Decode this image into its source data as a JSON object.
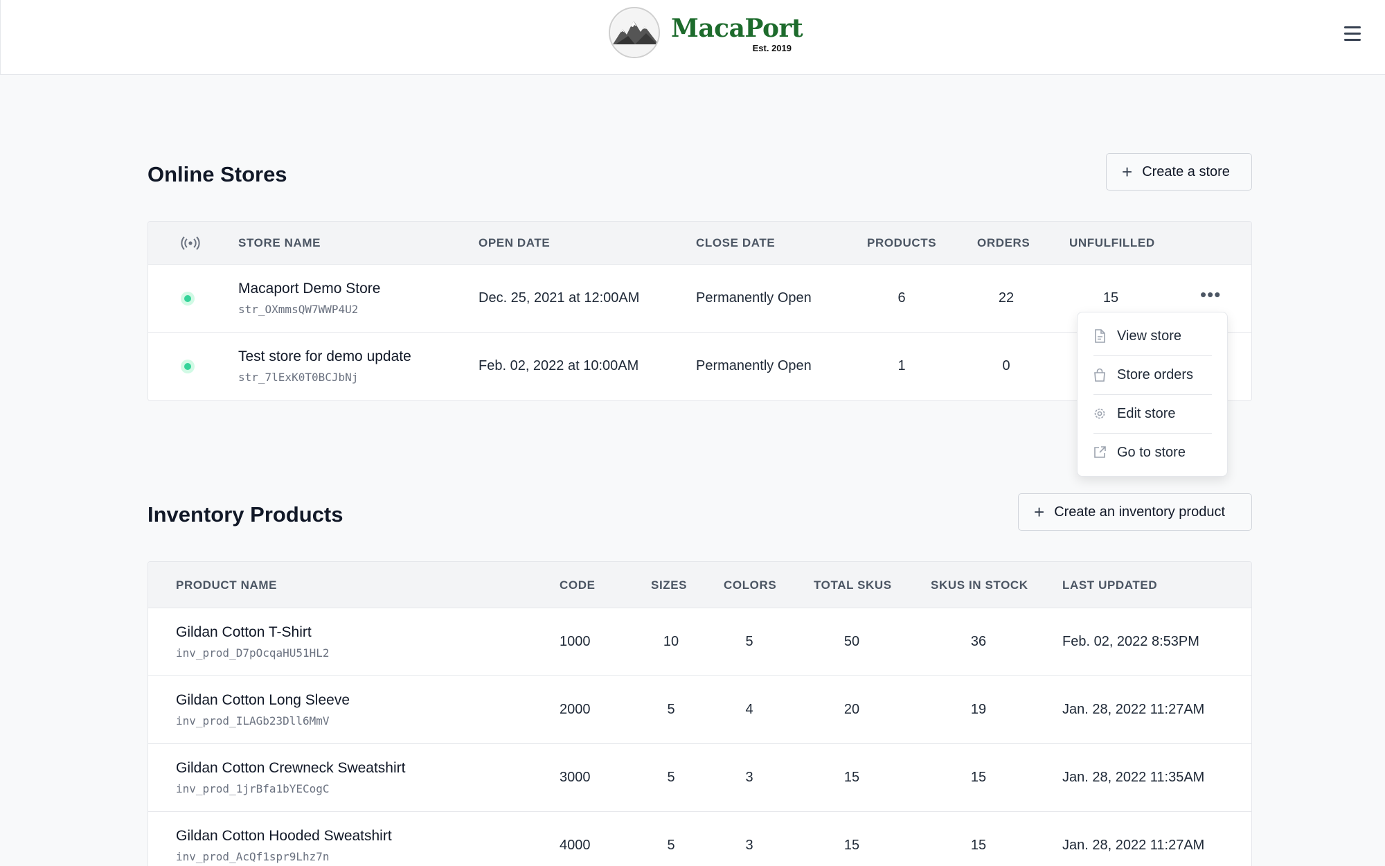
{
  "header": {
    "brand": "MacaPort",
    "established": "Est. 2019"
  },
  "stores": {
    "title": "Online Stores",
    "create_label": "Create a store",
    "columns": {
      "status_icon": "broadcast-icon",
      "store_name": "STORE NAME",
      "open_date": "OPEN DATE",
      "close_date": "CLOSE DATE",
      "products": "PRODUCTS",
      "orders": "ORDERS",
      "unfulfilled": "UNFULFILLED"
    },
    "rows": [
      {
        "status": "active",
        "name": "Macaport Demo Store",
        "id": "str_OXmmsQW7WWP4U2",
        "open_date": "Dec. 25, 2021 at 12:00AM",
        "close_date": "Permanently Open",
        "products": "6",
        "orders": "22",
        "unfulfilled": "15"
      },
      {
        "status": "active",
        "name": "Test store for demo update",
        "id": "str_7lExK0T0BCJbNj",
        "open_date": "Feb. 02, 2022 at 10:00AM",
        "close_date": "Permanently Open",
        "products": "1",
        "orders": "0",
        "unfulfilled": ""
      }
    ],
    "row_menu": {
      "items": [
        {
          "label": "View store",
          "icon": "document-icon"
        },
        {
          "label": "Store orders",
          "icon": "shopping-bag-icon"
        },
        {
          "label": "Edit store",
          "icon": "gear-icon"
        },
        {
          "label": "Go to store",
          "icon": "external-link-icon"
        }
      ]
    }
  },
  "inventory": {
    "title": "Inventory Products",
    "create_label": "Create an inventory product",
    "columns": {
      "product_name": "PRODUCT NAME",
      "code": "CODE",
      "sizes": "SIZES",
      "colors": "COLORS",
      "total_skus": "TOTAL SKUS",
      "skus_in_stock": "SKUS IN STOCK",
      "last_updated": "LAST UPDATED"
    },
    "rows": [
      {
        "name": "Gildan Cotton T-Shirt",
        "id": "inv_prod_D7pOcqaHU51HL2",
        "code": "1000",
        "sizes": "10",
        "colors": "5",
        "total_skus": "50",
        "skus_in_stock": "36",
        "last_updated": "Feb. 02, 2022 8:53PM"
      },
      {
        "name": "Gildan Cotton Long Sleeve",
        "id": "inv_prod_ILAGb23Dll6MmV",
        "code": "2000",
        "sizes": "5",
        "colors": "4",
        "total_skus": "20",
        "skus_in_stock": "19",
        "last_updated": "Jan. 28, 2022 11:27AM"
      },
      {
        "name": "Gildan Cotton Crewneck Sweatshirt",
        "id": "inv_prod_1jrBfa1bYECogC",
        "code": "3000",
        "sizes": "5",
        "colors": "3",
        "total_skus": "15",
        "skus_in_stock": "15",
        "last_updated": "Jan. 28, 2022 11:35AM"
      },
      {
        "name": "Gildan Cotton Hooded Sweatshirt",
        "id": "inv_prod_AcQf1spr9Lhz7n",
        "code": "4000",
        "sizes": "5",
        "colors": "3",
        "total_skus": "15",
        "skus_in_stock": "15",
        "last_updated": "Jan. 28, 2022 11:27AM"
      }
    ]
  },
  "colors": {
    "brand_green": "#1d6b2c",
    "status_active": "#34d399"
  }
}
